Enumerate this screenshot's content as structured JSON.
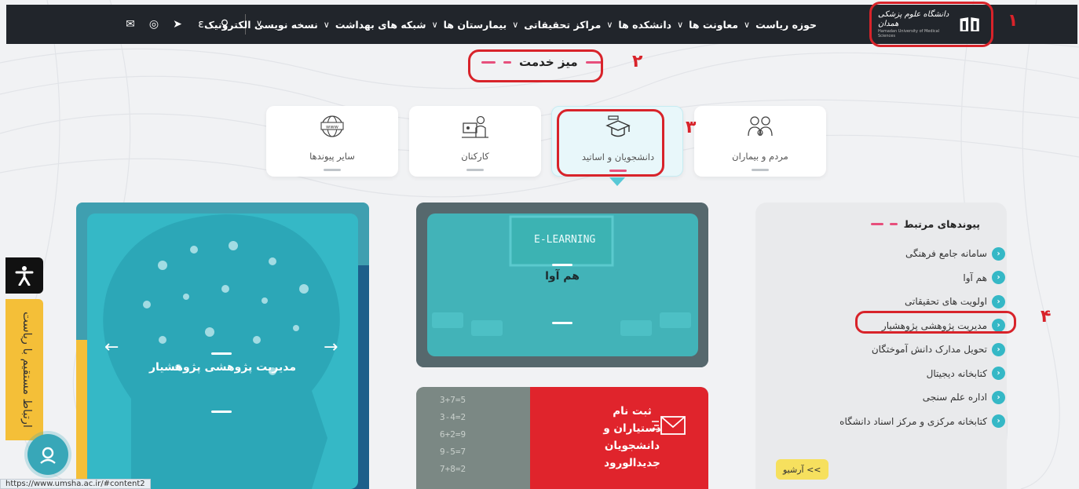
{
  "nav": {
    "logo_text": "دانشگاه علوم پزشکی همدان",
    "logo_subtext": "Hamadan University of Medical Sciences",
    "menu": [
      "حوزه ریاست",
      "معاونت ها",
      "دانشکده ها",
      "مراکز تحقیقاتی",
      "بیمارستان ها",
      "شبکه های بهداشت",
      "نسخه نویسی الکترونیک"
    ],
    "icons": [
      "message-icon",
      "instagram-icon",
      "telegram-icon",
      "eitaa-icon",
      "search-icon"
    ]
  },
  "section": {
    "title": "میز خدمت"
  },
  "service_cards": [
    {
      "label": "سایر پیوندها",
      "icon": "web-icon"
    },
    {
      "label": "کارکنان",
      "icon": "staff-icon"
    },
    {
      "label": "دانشجویان و اساتید",
      "icon": "graduation-icon",
      "active": true
    },
    {
      "label": "مردم و بیماران",
      "icon": "patients-icon"
    }
  ],
  "slider": {
    "title": "مدیریت پژوهشی پژوهشیار"
  },
  "elearning": {
    "title": "هم آوا",
    "board_text": "E-LEARNING"
  },
  "registration": {
    "text": "ثبت نام دستیاران و دانشجویان جدیدالورود"
  },
  "related": {
    "title": "پیوندهای مرتبط",
    "items": [
      "سامانه جامع فرهنگی",
      "هم آوا",
      "اولویت های تحقیقاتی",
      "مدیریت پژوهشی پژوهشیار",
      "تحویل مدارک دانش آموختگان",
      "کتابخانه دیجیتال",
      "اداره علم سنجی",
      "کتابخانه مرکزی و مرکز اسناد دانشگاه"
    ],
    "archive_label": "آرشیو <<"
  },
  "side": {
    "contact_label": "ارتباط مستقیم با ریاست"
  },
  "annotations": [
    "۱",
    "۲",
    "۳",
    "۴"
  ],
  "status_url": "https://www.umsha.ac.ir/#content2",
  "colors": {
    "nav": "#21252b",
    "teal": "#35b8c6",
    "accent_pink": "#e74f7c",
    "annotation_red": "#d8232a",
    "yellow": "#f4bf38",
    "register_red": "#e0242c"
  }
}
